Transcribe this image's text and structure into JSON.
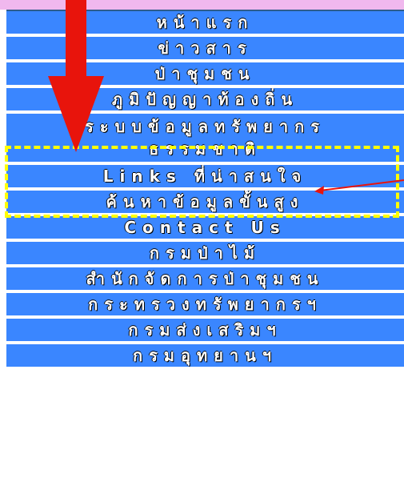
{
  "menu": {
    "items": [
      {
        "label": "หน้าแรก"
      },
      {
        "label": "ข่าวสาร"
      },
      {
        "label": "ป่าชุมชน"
      },
      {
        "label": "ภูมิปัญญาท้องถิ่น"
      },
      {
        "label_line1": "ระบบข้อมูลทรัพยากร",
        "label_line2": "ธรรมชาติ"
      },
      {
        "label": "Links ที่น่าสนใจ"
      },
      {
        "label": "ค้นหาข้อมูลขั้นสูง"
      },
      {
        "label": "Contact Us"
      },
      {
        "label": "กรมป่าไม้"
      },
      {
        "label": "สำนักจัดการป่าชุมชน"
      },
      {
        "label": "กระทรวงทรัพยากรฯ"
      },
      {
        "label": "กรมส่งเสริมฯ"
      },
      {
        "label": "กรมอุทยานฯ"
      }
    ]
  },
  "annotations": {
    "highlight_color": "#ffff00",
    "arrow_color": "#e8140c"
  }
}
